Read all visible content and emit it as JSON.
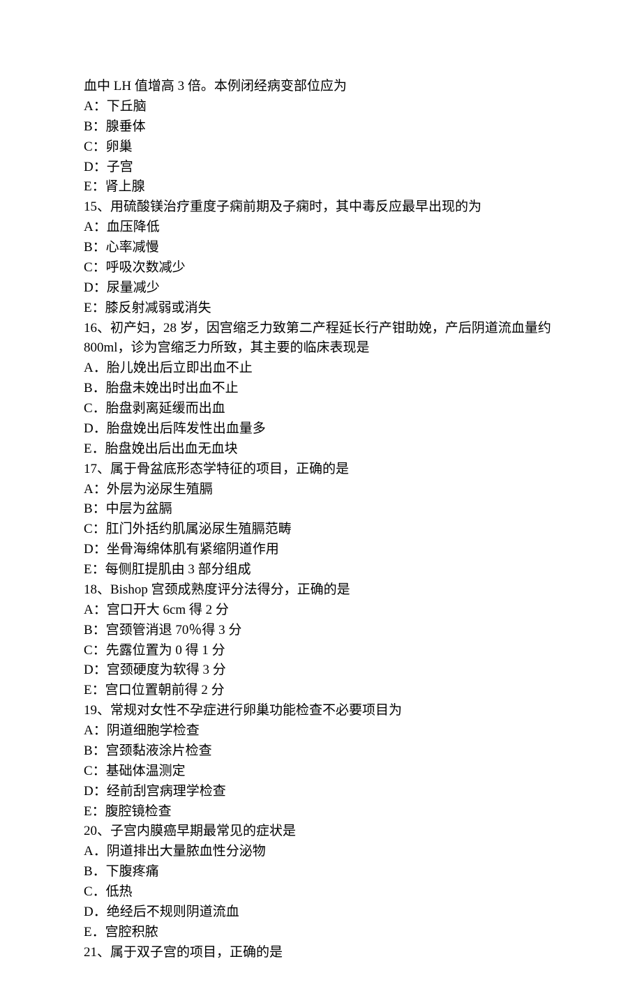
{
  "lines": [
    "血中 LH 值增高 3 倍。本例闭经病变部位应为",
    "A：下丘脑",
    "B：腺垂体",
    "C：卵巢",
    "D：子宫",
    "E：肾上腺",
    "15、用硫酸镁治疗重度子痫前期及子痫时，其中毒反应最早出现的为",
    "A：血压降低",
    "B：心率减慢",
    "C：呼吸次数减少",
    "D：尿量减少",
    "E：膝反射减弱或消失",
    "16、初产妇，28 岁，因宫缩乏力致第二产程延长行产钳助娩，产后阴道流血量约 800ml，诊为宫缩乏力所致，其主要的临床表现是",
    "A．胎儿娩出后立即出血不止",
    "B．胎盘未娩出时出血不止",
    "C．胎盘剥离延缓而出血",
    "D．胎盘娩出后阵发性出血量多",
    "E．胎盘娩出后出血无血块",
    "17、属于骨盆底形态学特征的项目，正确的是",
    "A：外层为泌尿生殖膈",
    "B：中层为盆膈",
    "C：肛门外括约肌属泌尿生殖膈范畴",
    "D：坐骨海绵体肌有紧缩阴道作用",
    "E：每侧肛提肌由 3 部分组成",
    "18、Bishop 宫颈成熟度评分法得分，正确的是",
    "A：宫口开大 6cm 得 2 分",
    "B：宫颈管消退 70％得 3 分",
    "C：先露位置为 0 得 1 分",
    "D：宫颈硬度为软得 3 分",
    "E：宫口位置朝前得 2 分",
    "19、常规对女性不孕症进行卵巢功能检查不必要项目为",
    "A：阴道细胞学检查",
    "B：宫颈黏液涂片检查",
    "C：基础体温测定",
    "D：经前刮宫病理学检查",
    "E：腹腔镜检查",
    "20、子宫内膜癌早期最常见的症状是",
    "A．阴道排出大量脓血性分泌物",
    "B．下腹疼痛",
    "C．低热",
    "D．绝经后不规则阴道流血",
    "E．宫腔积脓",
    "21、属于双子宫的项目，正确的是"
  ]
}
